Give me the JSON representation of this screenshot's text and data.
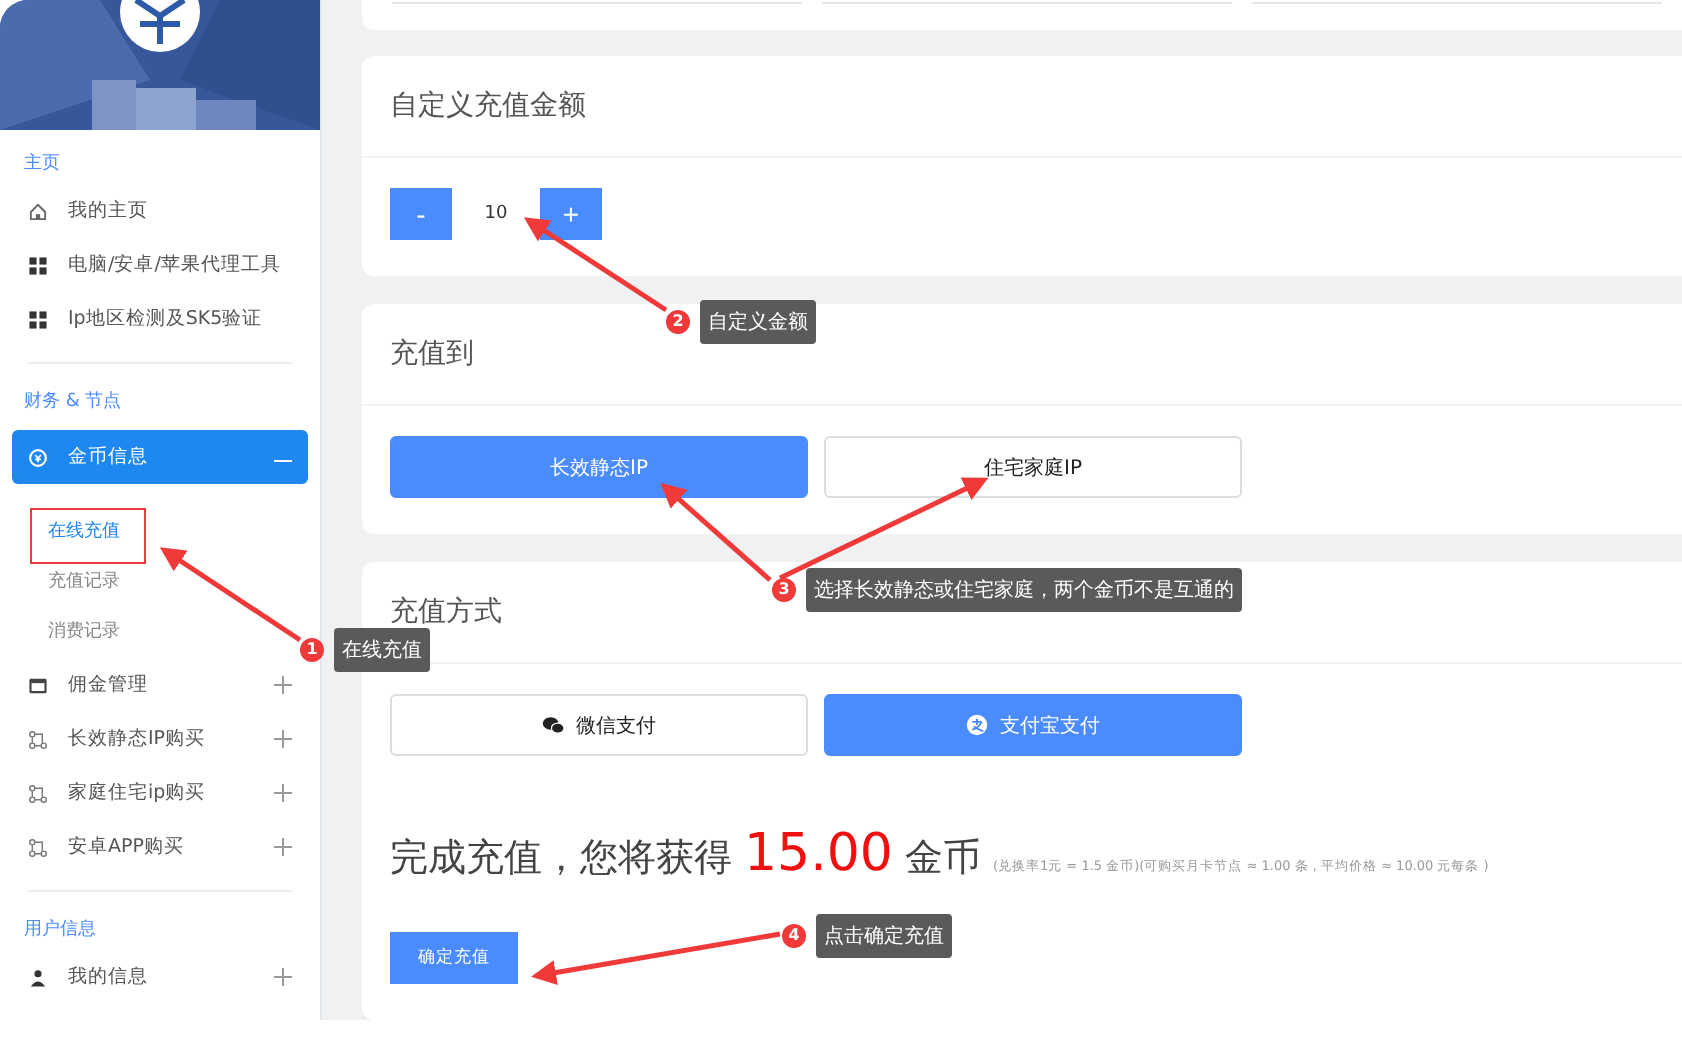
{
  "sidebar": {
    "sections": [
      {
        "title": "主页",
        "items": [
          {
            "label": "我的主页",
            "kind": "home",
            "selected": false
          },
          {
            "label": "电脑/安卓/苹果代理工具",
            "kind": "grid",
            "selected": false
          },
          {
            "label": "Ip地区检测及SK5验证",
            "kind": "grid",
            "selected": false
          }
        ]
      },
      {
        "title": "财务 & 节点",
        "items": [
          {
            "label": "金币信息",
            "kind": "coin",
            "selected": true,
            "expanded": true,
            "children": [
              {
                "label": "在线充值",
                "selected": true
              },
              {
                "label": "充值记录",
                "selected": false
              },
              {
                "label": "消费记录",
                "selected": false
              }
            ]
          },
          {
            "label": "佣金管理",
            "kind": "card",
            "selected": false,
            "expanded": false
          },
          {
            "label": "长效静态IP购买",
            "kind": "nodes",
            "selected": false,
            "expanded": false
          },
          {
            "label": "家庭住宅ip购买",
            "kind": "nodes",
            "selected": false,
            "expanded": false
          },
          {
            "label": "安卓APP购买",
            "kind": "nodes",
            "selected": false,
            "expanded": false
          }
        ]
      },
      {
        "title": "用户信息",
        "items": [
          {
            "label": "我的信息",
            "kind": "user",
            "selected": false,
            "expanded": false
          }
        ]
      }
    ]
  },
  "custom_amount": {
    "title": "自定义充值金额",
    "decrement_label": "-",
    "value": "10",
    "increment_label": "+"
  },
  "recharge_to": {
    "title": "充值到",
    "options": [
      {
        "label": "长效静态IP",
        "selected": true
      },
      {
        "label": "住宅家庭IP",
        "selected": false
      }
    ]
  },
  "payment": {
    "title": "充值方式",
    "methods": [
      {
        "label": "微信支付",
        "kind": "wechat",
        "selected": false
      },
      {
        "label": "支付宝支付",
        "kind": "alipay",
        "selected": true
      }
    ]
  },
  "summary": {
    "prefix": "完成充值，您将获得",
    "amount": "15.00",
    "unit": "金币",
    "note": "(兑换率1元 = 1.5 金币)(可购买月卡节点 ≈ 1.00 条 , 平均价格 ≈ 10.00 元每条 )"
  },
  "confirm_button": "确定充值",
  "annotations": [
    {
      "number": "1",
      "text": "在线充值"
    },
    {
      "number": "2",
      "text": "自定义金额"
    },
    {
      "number": "3",
      "text": "选择长效静态或住宅家庭，两个金币不是互通的"
    },
    {
      "number": "4",
      "text": "点击确定充值"
    }
  ]
}
